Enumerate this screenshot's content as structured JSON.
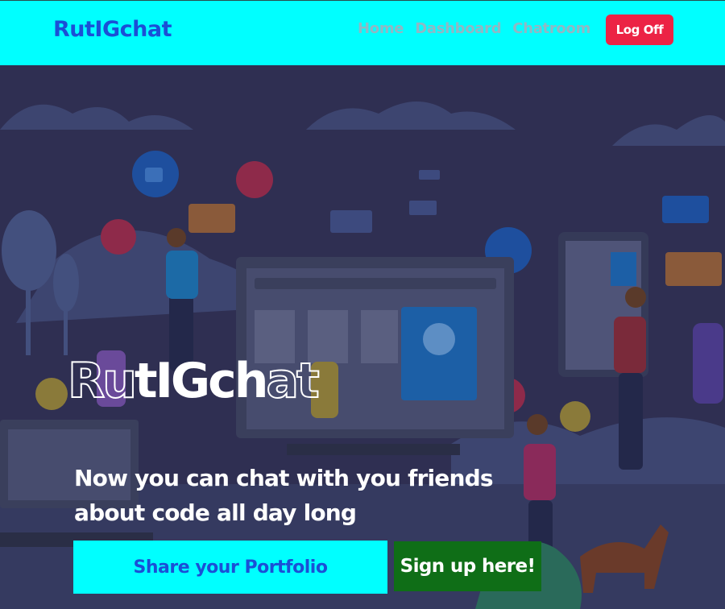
{
  "navbar": {
    "brand": "RutIGchat",
    "links": [
      {
        "label": "Home"
      },
      {
        "label": "Dashboard"
      },
      {
        "label": "Chatroom"
      }
    ],
    "logoff_label": "Log Off"
  },
  "hero": {
    "title_parts": [
      "Ru",
      "tIGch",
      "at"
    ],
    "subtitle_line1": "Now you can chat with you friends",
    "subtitle_line2": "about code all day long",
    "portfolio_button": "Share your Portfolio",
    "signup_button": "Sign up here!"
  },
  "colors": {
    "navbar_bg": "#00ffff",
    "brand": "#1b4fd6",
    "nav_link": "#8fb8c4",
    "logoff_bg": "#ec2345",
    "hero_overlay": "#2f2f52",
    "portfolio_bg": "#00ffff",
    "signup_bg": "#0f6e17"
  }
}
